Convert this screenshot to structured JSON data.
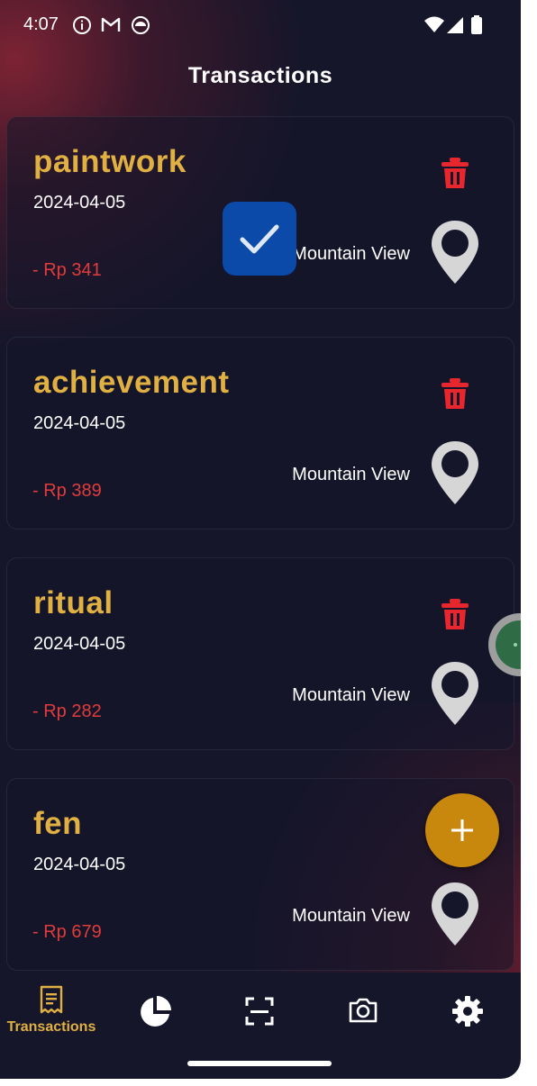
{
  "status_bar": {
    "time": "4:07"
  },
  "header": {
    "title": "Transactions"
  },
  "transactions": [
    {
      "name": "paintwork",
      "date": "2024-04-05",
      "amount": "- Rp 341",
      "place": "Mountain View"
    },
    {
      "name": "achievement",
      "date": "2024-04-05",
      "amount": "- Rp 389",
      "place": "Mountain View"
    },
    {
      "name": "ritual",
      "date": "2024-04-05",
      "amount": "- Rp 282",
      "place": "Mountain View"
    },
    {
      "name": "fen",
      "date": "2024-04-05",
      "amount": "- Rp 679",
      "place": "Mountain View"
    }
  ],
  "nav": {
    "items": [
      {
        "icon": "receipt-icon",
        "label": "Transactions",
        "active": true
      },
      {
        "icon": "pie-chart-icon",
        "label": ""
      },
      {
        "icon": "scan-frame-icon",
        "label": ""
      },
      {
        "icon": "camera-icon",
        "label": ""
      },
      {
        "icon": "gear-icon",
        "label": ""
      }
    ]
  },
  "colors": {
    "background": "#16162a",
    "accent": "#e0b042",
    "expense": "#e03c3c",
    "fab": "#c8880e",
    "checkbox": "#0b4aa8"
  }
}
